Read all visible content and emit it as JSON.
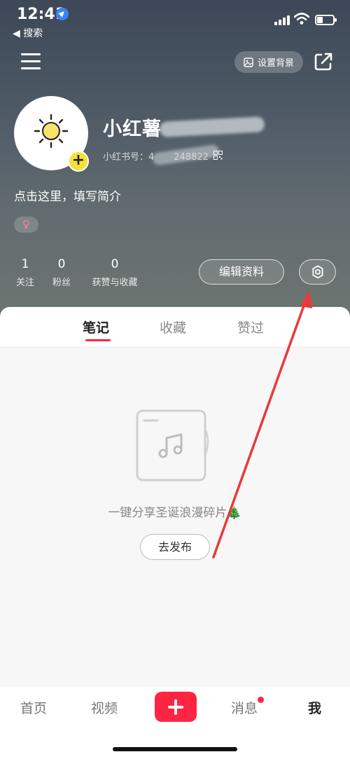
{
  "status_bar": {
    "time": "12:41",
    "back_label": "◀ 搜索"
  },
  "header": {
    "set_background_label": "设置背景"
  },
  "profile": {
    "nickname": "小红薯",
    "id_label": "小红书号：4",
    "id_tail": "248822",
    "bio": "点击这里，填写简介",
    "gender_symbol": "♀",
    "stats": [
      {
        "value": "1",
        "label": "关注"
      },
      {
        "value": "0",
        "label": "粉丝"
      },
      {
        "value": "0",
        "label": "获赞与收藏"
      }
    ],
    "edit_label": "编辑资料"
  },
  "tabs": [
    {
      "label": "笔记",
      "active": true
    },
    {
      "label": "收藏",
      "active": false
    },
    {
      "label": "赞过",
      "active": false
    }
  ],
  "empty_state": {
    "text": "一键分享圣诞浪漫碎片🎄",
    "publish_label": "去发布"
  },
  "bottom_nav": {
    "home": "首页",
    "video": "视频",
    "messages": "消息",
    "me": "我"
  },
  "colors": {
    "accent": "#ff2442",
    "avatar_badge": "#f5e13a",
    "annotation_arrow": "#e83a3a"
  },
  "icons": [
    "location-arrow-icon",
    "signal-icon",
    "wifi-icon",
    "battery-icon",
    "menu-icon",
    "image-icon",
    "share-icon",
    "sun-icon",
    "plus-icon",
    "qr-code-icon",
    "gear-icon",
    "music-note-icon"
  ]
}
